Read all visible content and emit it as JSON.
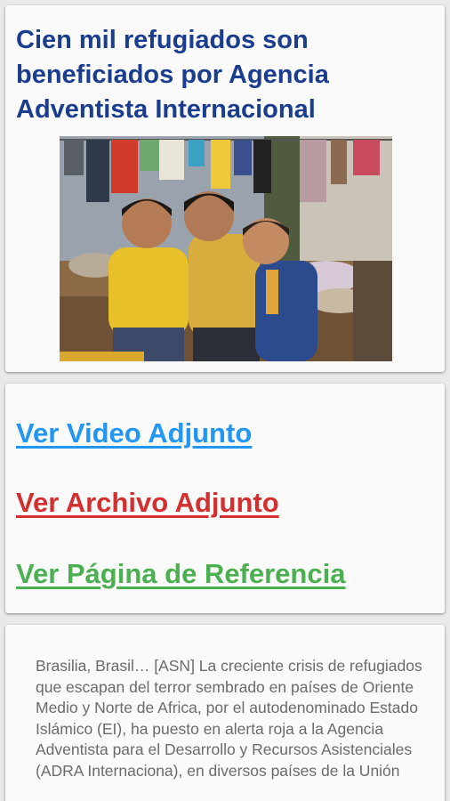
{
  "article": {
    "title": "Cien mil refugiados son beneficiados por Agencia Adventista Internacional",
    "body": "Brasilia, Brasil… [ASN] La creciente crisis de refugiados que escapan del terror sembrado en países de Oriente Medio y Norte de Africa, por el autodenominado Estado Islámico (EI), ha puesto en alerta roja a la Agencia Adventista para el Desarrollo y Recursos Asistenciales (ADRA Internaciona), en diversos países de la Unión"
  },
  "links": {
    "video": "Ver Video Adjunto",
    "file": "Ver Archivo Adjunto",
    "reference": "Ver Página de Referencia"
  },
  "colors": {
    "title": "#1a3d8f",
    "video_link": "#2196f3",
    "file_link": "#d32f2f",
    "reference_link": "#4caf50",
    "body_text": "#6b6b6b"
  }
}
